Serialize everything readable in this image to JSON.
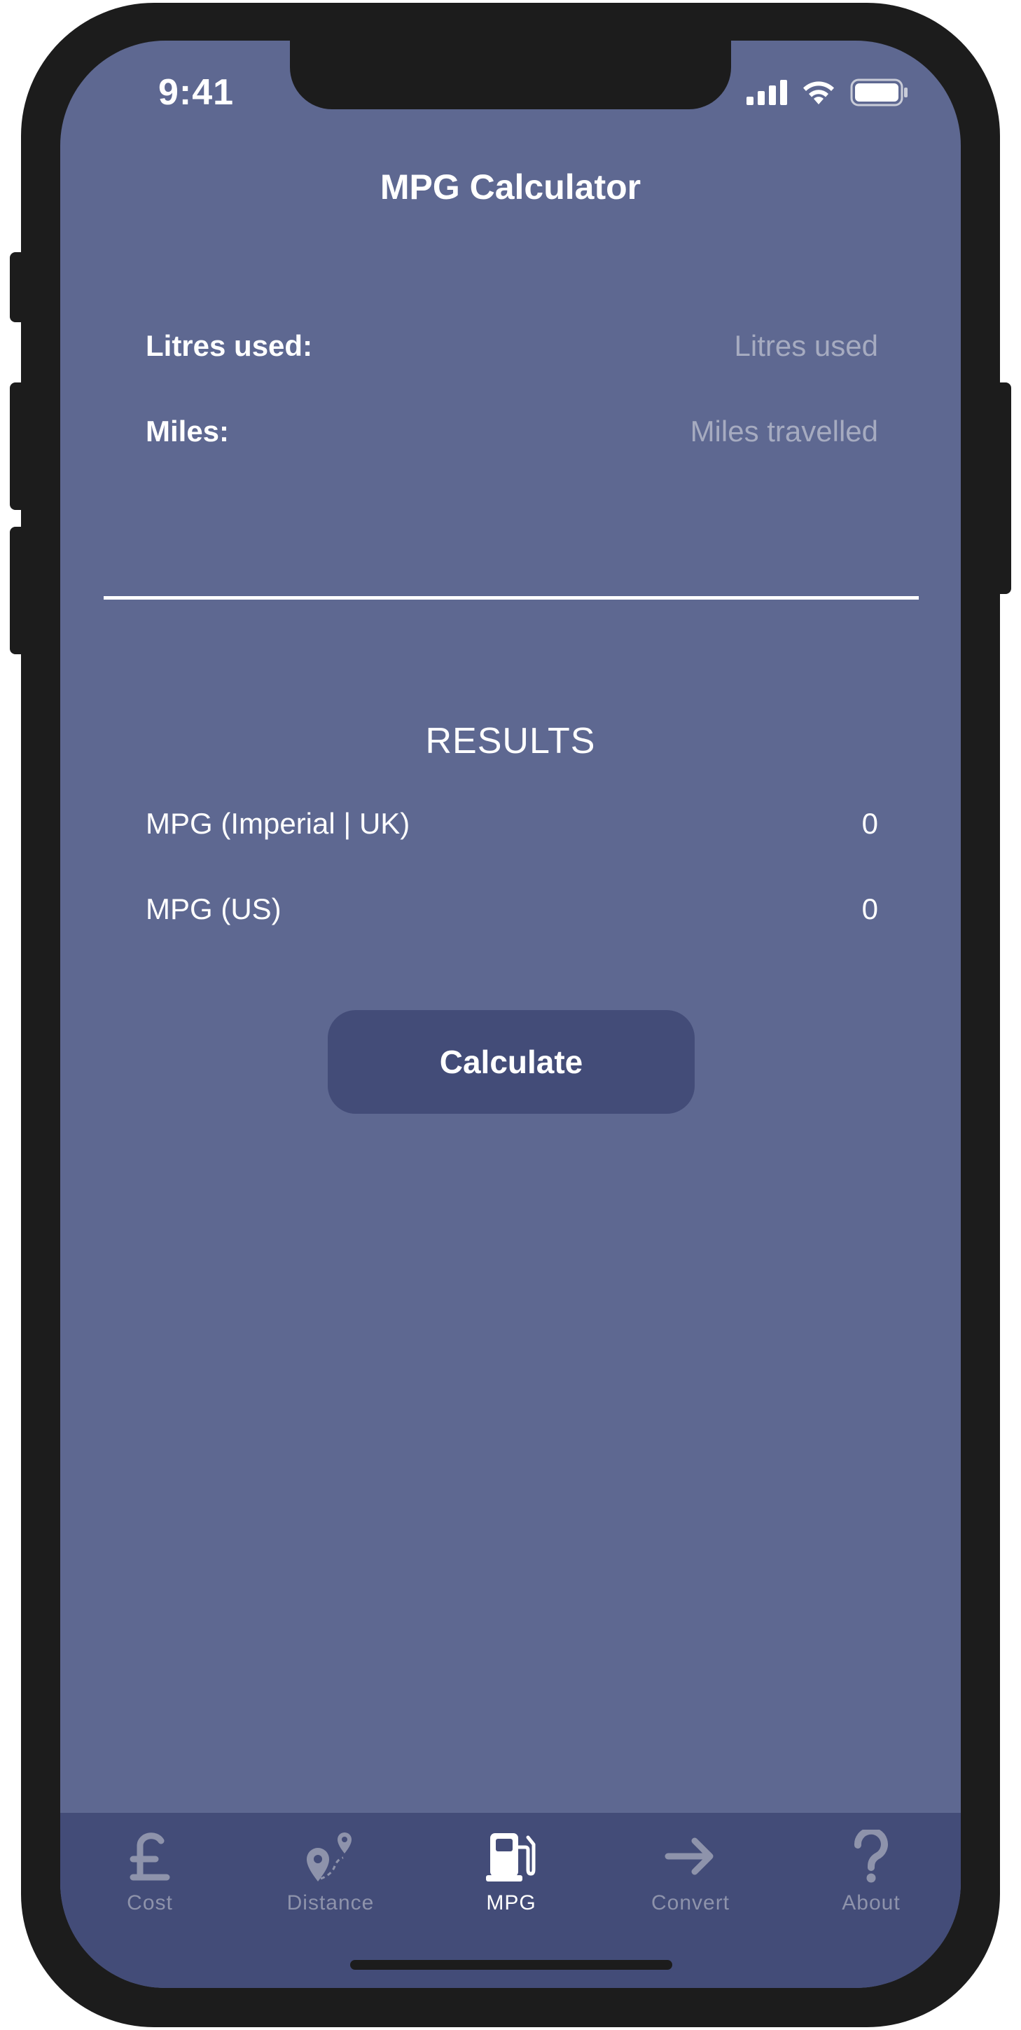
{
  "status_bar": {
    "time": "9:41"
  },
  "header": {
    "title": "MPG Calculator"
  },
  "inputs": [
    {
      "label": "Litres used:",
      "placeholder": "Litres used"
    },
    {
      "label": "Miles:",
      "placeholder": "Miles travelled"
    }
  ],
  "results": {
    "heading": "RESULTS",
    "rows": [
      {
        "label": "MPG (Imperial | UK)",
        "value": "0"
      },
      {
        "label": "MPG (US)",
        "value": "0"
      }
    ]
  },
  "actions": {
    "calculate_label": "Calculate"
  },
  "tabs": [
    {
      "label": "Cost",
      "icon": "pound-icon",
      "active": false
    },
    {
      "label": "Distance",
      "icon": "map-pin-route-icon",
      "active": false
    },
    {
      "label": "MPG",
      "icon": "fuel-pump-icon",
      "active": true
    },
    {
      "label": "Convert",
      "icon": "arrow-right-icon",
      "active": false
    },
    {
      "label": "About",
      "icon": "question-icon",
      "active": false
    }
  ],
  "colors": {
    "background": "#5e6891",
    "tabbar": "#434c78",
    "button": "#434c78",
    "text": "#ffffff",
    "placeholder": "#a6abc0",
    "inactive_tab": "#8e93ab"
  }
}
